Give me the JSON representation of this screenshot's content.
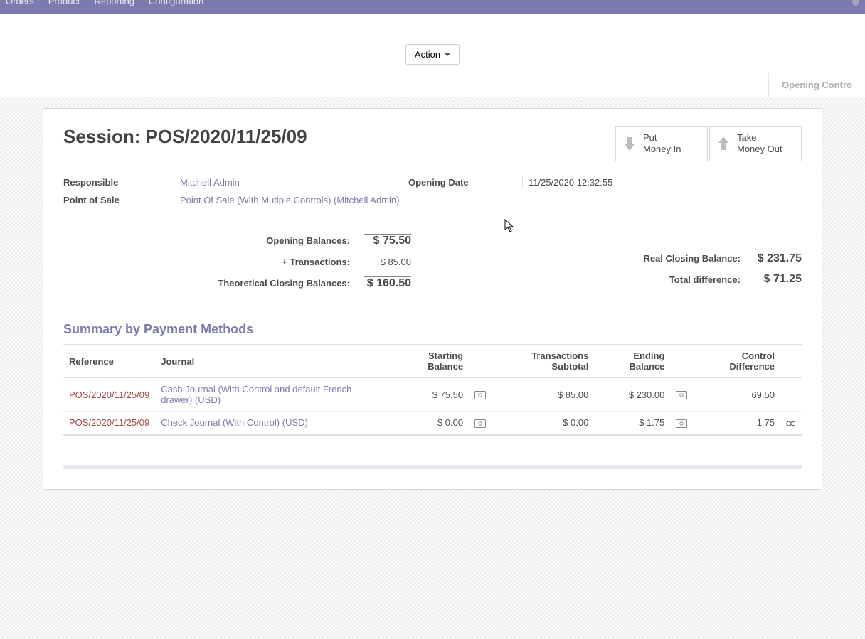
{
  "nav": {
    "items": [
      "Orders",
      "Product",
      "Reporting",
      "Configuration"
    ]
  },
  "actionbar": {
    "action_label": "Action"
  },
  "statusbar": {
    "stage": "Opening Contro"
  },
  "session": {
    "title": "Session: POS/2020/11/25/09",
    "put_money_in_l1": "Put",
    "put_money_in_l2": "Money In",
    "take_money_out_l1": "Take",
    "take_money_out_l2": "Money Out"
  },
  "info": {
    "responsible_label": "Responsible",
    "responsible_value": "Mitchell Admin",
    "opening_date_label": "Opening Date",
    "opening_date_value": "11/25/2020 12:32:55",
    "point_of_sale_label": "Point of Sale",
    "point_of_sale_value": "Point Of Sale (With Mutiple Controls) (Mitchell Admin)"
  },
  "balances": {
    "opening_label": "Opening Balances:",
    "opening_value": "$ 75.50",
    "transactions_label": "+ Transactions:",
    "transactions_value": "$ 85.00",
    "theoretical_label": "Theoretical Closing Balances:",
    "theoretical_value": "$ 160.50",
    "real_closing_label": "Real Closing Balance:",
    "real_closing_value": "$ 231.75",
    "total_diff_label": "Total difference:",
    "total_diff_value": "$ 71.25"
  },
  "summary": {
    "title": "Summary by Payment Methods",
    "columns": {
      "reference": "Reference",
      "journal": "Journal",
      "starting_balance": "Starting Balance",
      "transactions_subtotal": "Transactions Subtotal",
      "ending_balance": "Ending Balance",
      "control_difference": "Control Difference"
    },
    "rows": [
      {
        "reference": "POS/2020/11/25/09",
        "journal": "Cash Journal (With Control and default French drawer) (USD)",
        "starting_balance": "$ 75.50",
        "transactions_subtotal": "$ 85.00",
        "ending_balance": "$ 230.00",
        "control_difference": "69.50"
      },
      {
        "reference": "POS/2020/11/25/09",
        "journal": "Check Journal (With Control) (USD)",
        "starting_balance": "$ 0.00",
        "transactions_subtotal": "$ 0.00",
        "ending_balance": "$ 1.75",
        "control_difference": "1.75"
      }
    ]
  }
}
